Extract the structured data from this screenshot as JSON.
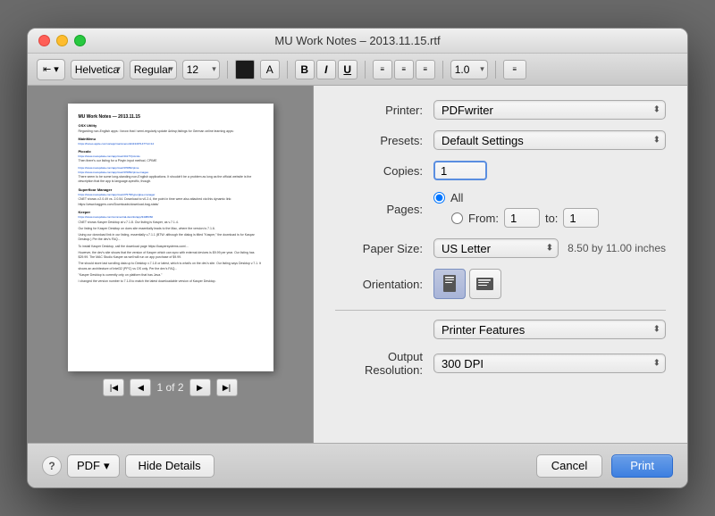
{
  "window": {
    "title": "MU Work Notes – 2013.11.15.rtf"
  },
  "toolbar": {
    "font_family": "Helvetica",
    "font_style": "Regular",
    "font_size": "12",
    "bold_label": "B",
    "italic_label": "I",
    "underline_label": "U",
    "line_spacing": "1.0"
  },
  "print_settings": {
    "printer_label": "Printer:",
    "printer_value": "PDFwriter",
    "presets_label": "Presets:",
    "presets_value": "Default Settings",
    "copies_label": "Copies:",
    "copies_value": "1",
    "pages_label": "Pages:",
    "pages_all": "All",
    "pages_from": "From:",
    "pages_from_value": "1",
    "pages_to": "to:",
    "pages_to_value": "1",
    "paper_size_label": "Paper Size:",
    "paper_size_value": "US Letter",
    "paper_dimensions": "8.50 by 11.00 inches",
    "orientation_label": "Orientation:",
    "printer_features_section": "Printer Features",
    "output_resolution_label": "Output Resolution:",
    "output_resolution_value": "300 DPI"
  },
  "pagination": {
    "page_info": "1 of 2"
  },
  "buttons": {
    "help": "?",
    "pdf": "PDF",
    "pdf_chevron": "▾",
    "hide_details": "Hide Details",
    "cancel": "Cancel",
    "print": "Print"
  }
}
